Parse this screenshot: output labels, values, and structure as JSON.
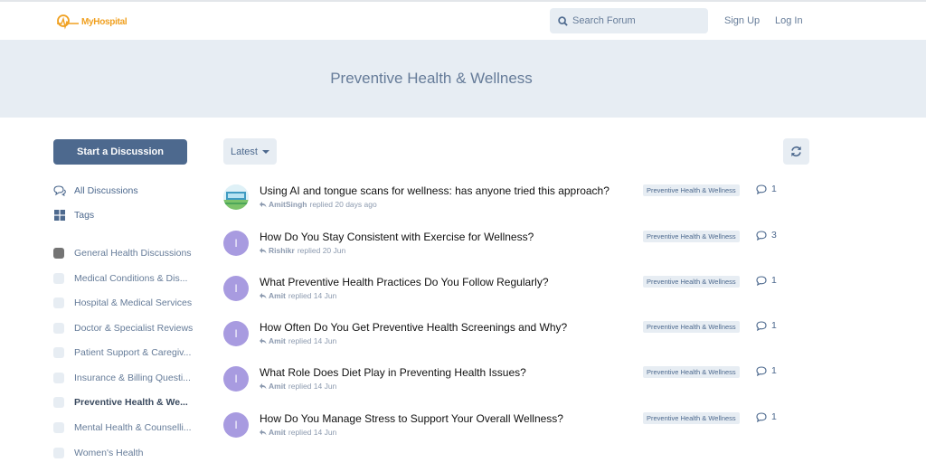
{
  "header": {
    "logo_text": "MyHospital",
    "search_placeholder": "Search Forum",
    "signup_label": "Sign Up",
    "login_label": "Log In"
  },
  "hero": {
    "title": "Preventive Health & Wellness"
  },
  "sidebar": {
    "start_label": "Start a Discussion",
    "nav": [
      {
        "label": "All Discussions",
        "icon": "comments-icon"
      },
      {
        "label": "Tags",
        "icon": "tags-grid-icon"
      }
    ],
    "tags": [
      {
        "label": "General Health Discussions"
      },
      {
        "label": "Medical Conditions & Dis..."
      },
      {
        "label": "Hospital & Medical Services"
      },
      {
        "label": "Doctor & Specialist Reviews"
      },
      {
        "label": "Patient Support & Caregiv..."
      },
      {
        "label": "Insurance & Billing Questi..."
      },
      {
        "label": "Preventive Health & We..."
      },
      {
        "label": "Mental Health & Counselli..."
      },
      {
        "label": "Women's Health"
      }
    ]
  },
  "toolbar": {
    "sort_label": "Latest"
  },
  "discussions": [
    {
      "title": "Using AI and tongue scans for wellness: has anyone tried this approach?",
      "user": "AmitSingh",
      "action": "replied 20 days ago",
      "tag": "Preventive Health & Wellness",
      "replies": "1",
      "avatar": ""
    },
    {
      "title": "How Do You Stay Consistent with Exercise for Wellness?",
      "user": "Rishikr",
      "action": "replied 20 Jun",
      "tag": "Preventive Health & Wellness",
      "replies": "3",
      "avatar": "I"
    },
    {
      "title": "What Preventive Health Practices Do You Follow Regularly?",
      "user": "Amit",
      "action": "replied 14 Jun",
      "tag": "Preventive Health & Wellness",
      "replies": "1",
      "avatar": "I"
    },
    {
      "title": "How Often Do You Get Preventive Health Screenings and Why?",
      "user": "Amit",
      "action": "replied 14 Jun",
      "tag": "Preventive Health & Wellness",
      "replies": "1",
      "avatar": "I"
    },
    {
      "title": "What Role Does Diet Play in Preventing Health Issues?",
      "user": "Amit",
      "action": "replied 14 Jun",
      "tag": "Preventive Health & Wellness",
      "replies": "1",
      "avatar": "I"
    },
    {
      "title": "How Do You Manage Stress to Support Your Overall Wellness?",
      "user": "Amit",
      "action": "replied 14 Jun",
      "tag": "Preventive Health & Wellness",
      "replies": "1",
      "avatar": "I"
    }
  ],
  "colors": {
    "accent": "#4d698e",
    "hero_bg": "#e7edf3",
    "avatar": "#a89be0",
    "logo": "#f0a020"
  }
}
